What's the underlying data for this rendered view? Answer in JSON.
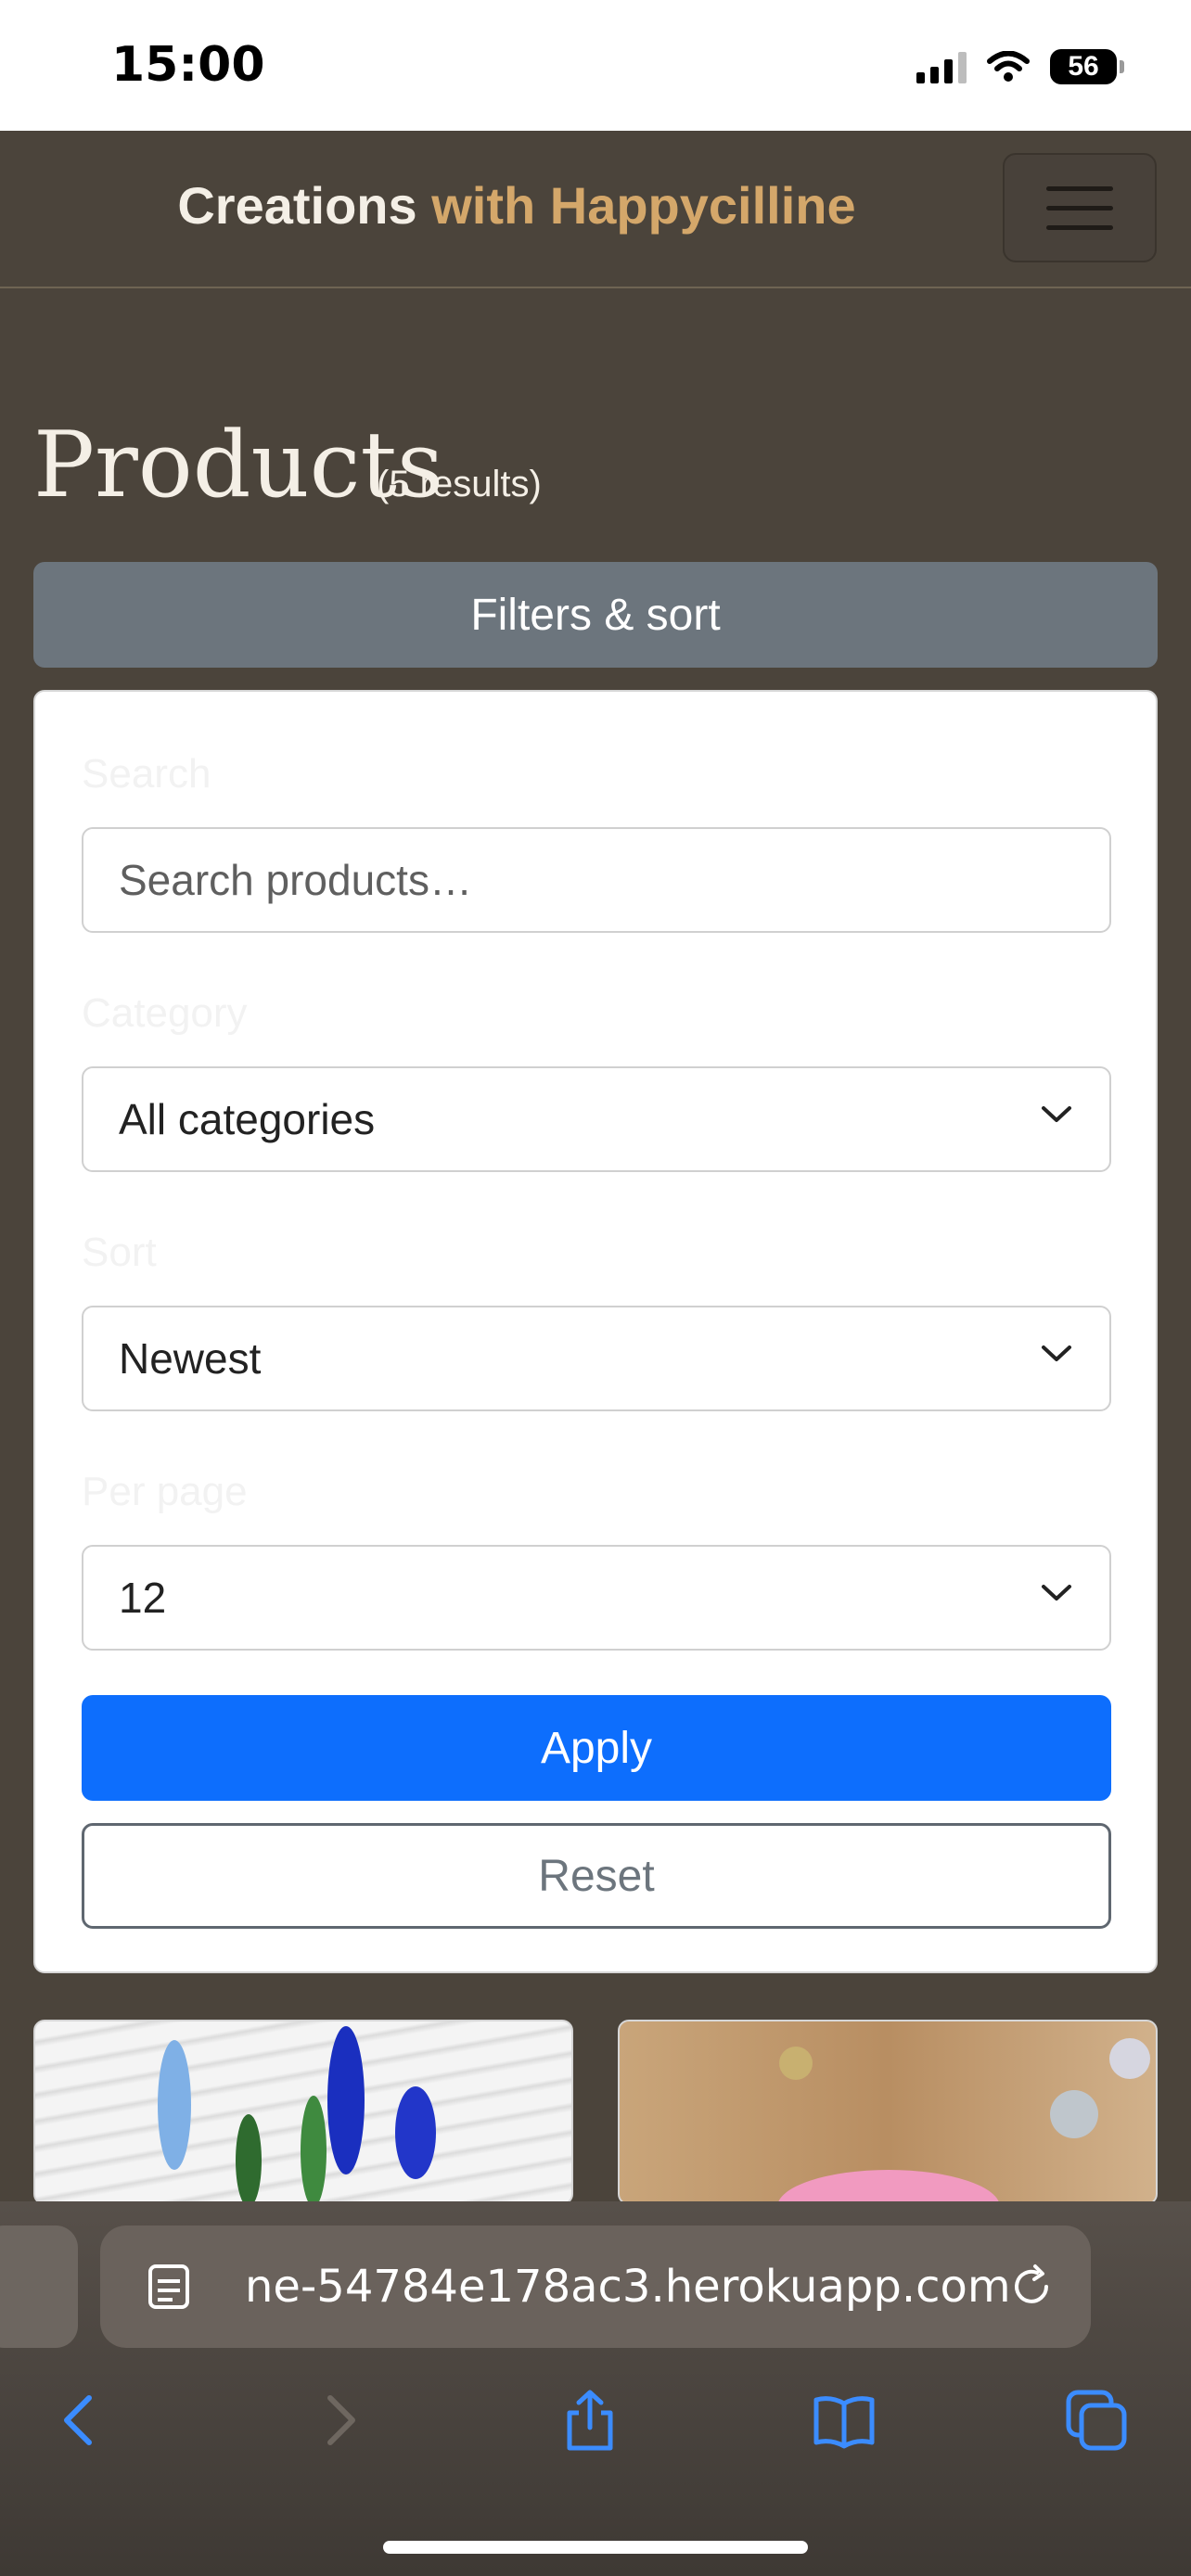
{
  "status_bar": {
    "time": "15:00",
    "battery": "56"
  },
  "navbar": {
    "brand_main": "Creations",
    "brand_accent": "with Happycilline",
    "menu_icon": "hamburger-icon"
  },
  "page": {
    "title": "Products",
    "results": "(5 results)"
  },
  "filters": {
    "toggle_label": "Filters & sort",
    "search_label": "Search",
    "search_placeholder": "Search products…",
    "category_label": "Category",
    "category_value": "All categories",
    "sort_label": "Sort",
    "sort_value": "Newest",
    "per_page_label": "Per page",
    "per_page_value": "12",
    "apply_label": "Apply",
    "reset_label": "Reset"
  },
  "browser": {
    "url": "ne-54784e178ac3.herokuapp.com",
    "icons": [
      "reader-icon",
      "reload-icon",
      "back-icon",
      "forward-icon",
      "share-icon",
      "bookmarks-icon",
      "tabs-icon"
    ]
  },
  "colors": {
    "background": "#4b443b",
    "brand_accent": "#d4a76a",
    "primary": "#0d6efd",
    "secondary": "#6c757d"
  }
}
